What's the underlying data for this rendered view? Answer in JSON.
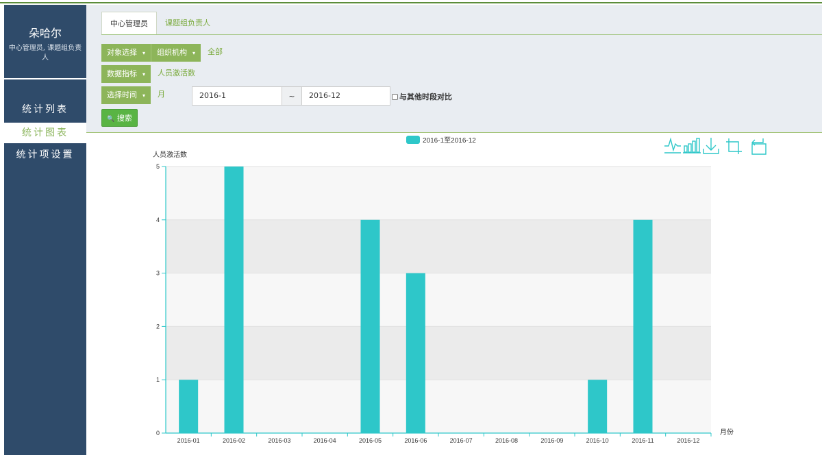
{
  "sidebar": {
    "user_name": "朵哈尔",
    "user_roles": "中心管理员, 课题组负责人",
    "items": [
      {
        "label": "统计列表"
      },
      {
        "label": "统计图表"
      },
      {
        "label": "统计项设置"
      }
    ],
    "active_index": 1
  },
  "tabs": [
    {
      "label": "中心管理员"
    },
    {
      "label": "课题组负责人"
    }
  ],
  "filters": {
    "object_label": "对象选择",
    "org_label": "组织机构",
    "org_value": "全部",
    "metric_label": "数据指标",
    "metric_value": "人员激活数",
    "time_label": "选择时间",
    "time_unit": "月",
    "date_from": "2016-1",
    "tilde": "~",
    "date_to": "2016-12",
    "compare_label": "与其他时段对比",
    "search_label": "搜索",
    "search_icon": "🔍"
  },
  "toolbar": {
    "icons": [
      "line-chart-icon",
      "bar-chart-icon",
      "download-icon",
      "zoom-icon",
      "zoom-reset-icon"
    ]
  },
  "chart_data": {
    "type": "bar",
    "legend": "2016-1至2016-12",
    "legend_position": "top-center",
    "ylabel": "人员激活数",
    "xlabel": "月份",
    "categories": [
      "2016-01",
      "2016-02",
      "2016-03",
      "2016-04",
      "2016-05",
      "2016-06",
      "2016-07",
      "2016-08",
      "2016-09",
      "2016-10",
      "2016-11",
      "2016-12"
    ],
    "values": [
      1,
      5,
      0,
      0,
      4,
      3,
      0,
      0,
      0,
      1,
      4,
      0
    ],
    "ylim": [
      0,
      5
    ],
    "yticks": [
      0,
      1,
      2,
      3,
      4,
      5
    ],
    "color": "#2ec7c9"
  },
  "colors": {
    "sidebar": "#2f4b6a",
    "accent_green": "#8db55a",
    "search_green": "#59b444",
    "bar": "#2ec7c9"
  }
}
